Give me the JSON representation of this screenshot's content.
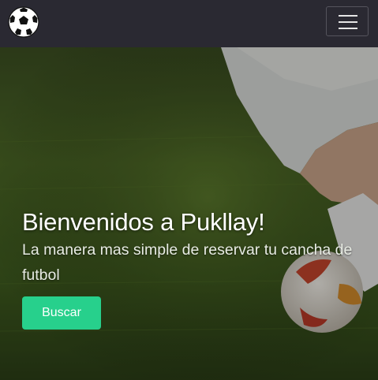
{
  "app": {
    "logo_icon": "soccer-ball-icon",
    "menu_icon": "hamburger-menu-icon"
  },
  "hero": {
    "title": "Bienvenidos a Pukllay!",
    "subtitle": "La manera mas simple de reservar tu cancha de futbol",
    "button_label": "Buscar"
  },
  "colors": {
    "navbar": "#2a2932",
    "button": "#27d08c",
    "text": "#ffffff"
  }
}
